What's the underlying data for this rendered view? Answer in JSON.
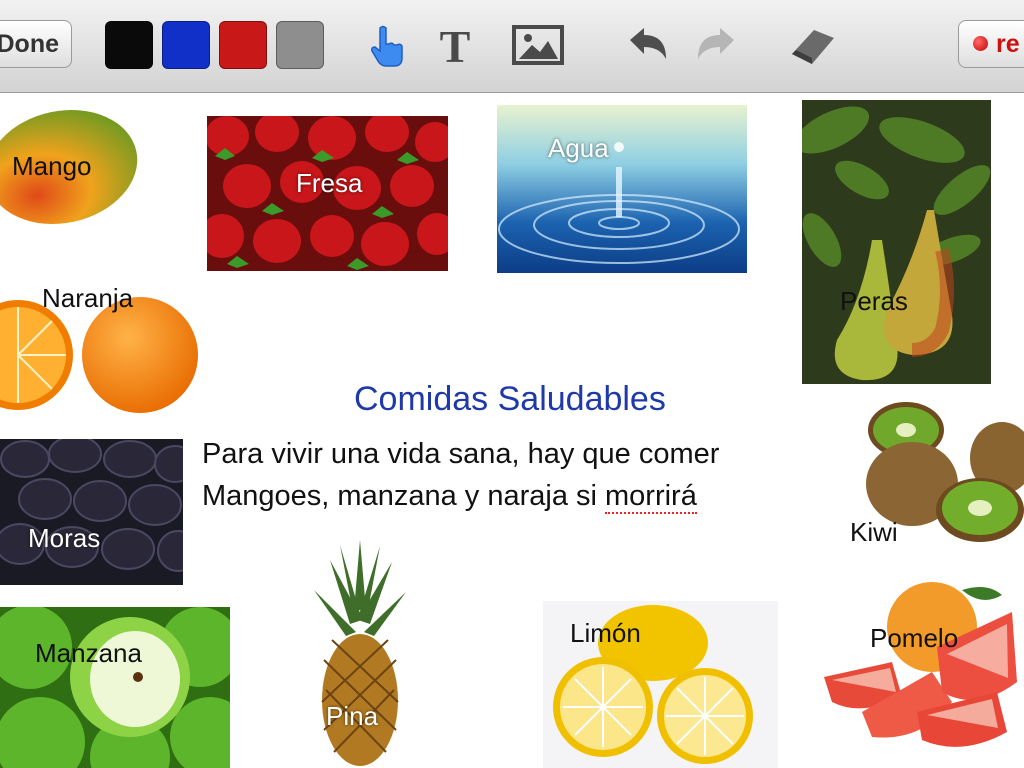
{
  "toolbar": {
    "done_label": "Done",
    "record_label": "re",
    "colors": [
      "#0a0a0a",
      "#1030c8",
      "#c81818",
      "#8e8e8e"
    ],
    "icons": [
      "pointer-hand-icon",
      "text-tool-icon",
      "image-tool-icon",
      "undo-icon",
      "redo-icon",
      "eraser-icon"
    ]
  },
  "canvas": {
    "title": "Comidas Saludables",
    "body_line1": "Para vivir una vida sana, hay que comer",
    "body_line2_prefix": "Mangoes, manzana y naraja si ",
    "body_line2_misspelled": "morrirá",
    "labels": {
      "mango": "Mango",
      "fresa": "Fresa",
      "agua": "Agua",
      "peras": "Peras",
      "naranja": "Naranja",
      "moras": "Moras",
      "kiwi": "Kiwi",
      "manzana": "Manzana",
      "pina": "Pina",
      "limon": "Limón",
      "pomelo": "Pomelo"
    }
  }
}
